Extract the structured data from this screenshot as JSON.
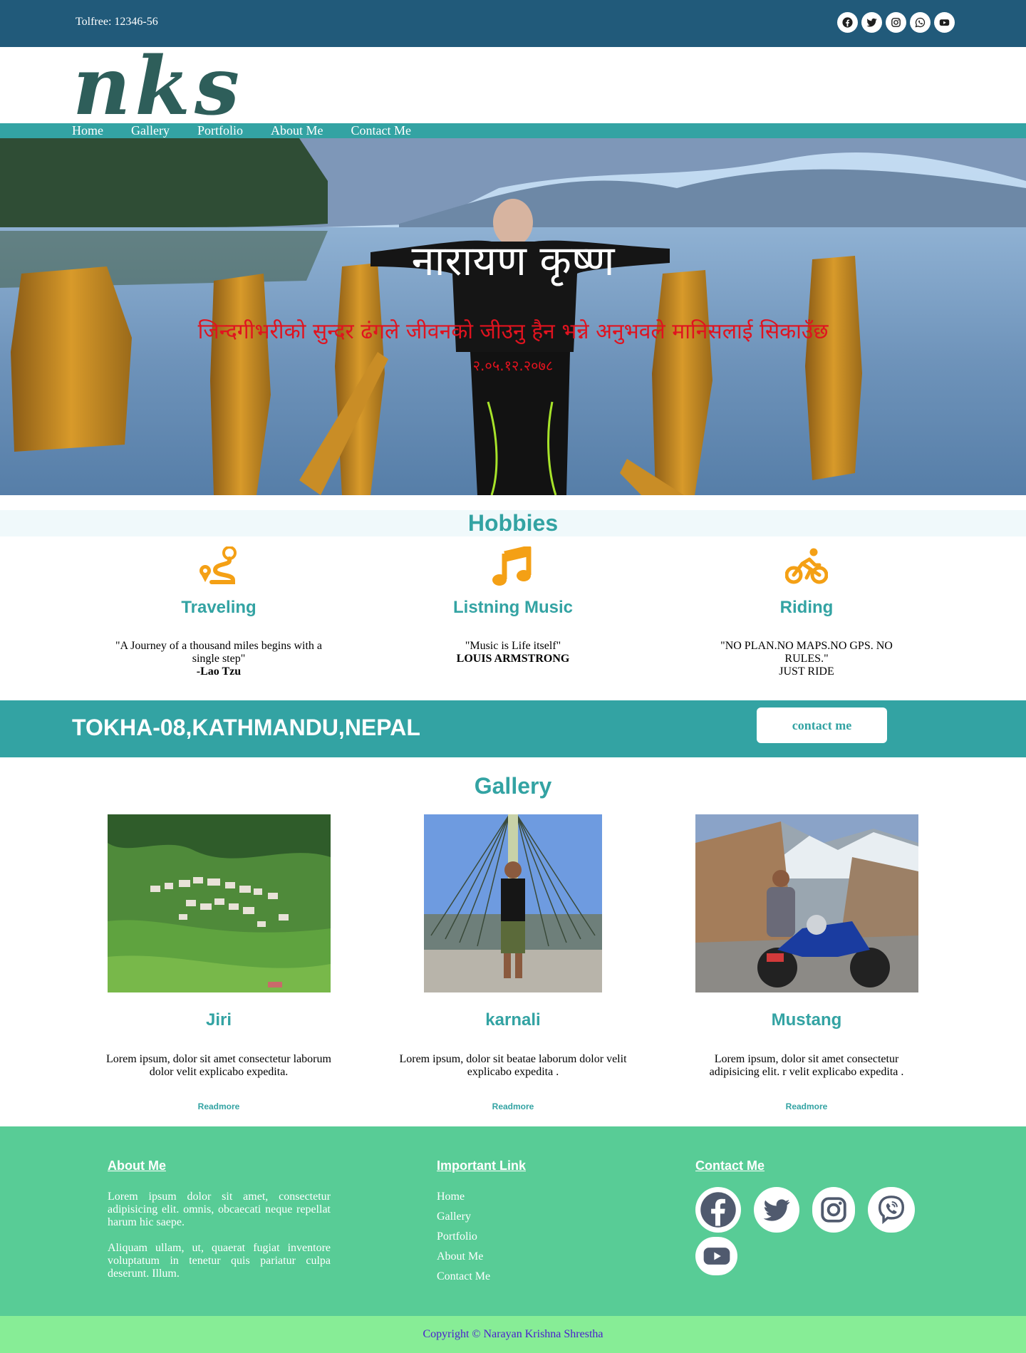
{
  "topbar": {
    "tollfree": "Tolfree: 12346-56",
    "socials": [
      "facebook-icon",
      "twitter-icon",
      "instagram-icon",
      "whatsapp-icon",
      "youtube-icon"
    ]
  },
  "logo": {
    "text": "nks"
  },
  "nav": {
    "items": [
      "Home",
      "Gallery",
      "Portfolio",
      "About Me",
      "Contact Me"
    ]
  },
  "hero": {
    "title": "नारायण कृष्ण",
    "quote": "जिन्दगीभरीको सुन्दर ढंगले जीवनको जीउनु हैन भन्ने अनुभवले मानिसलाई सिकाउँछ",
    "date": "२.०५.१२.२०७८"
  },
  "hobbies": {
    "heading": "Hobbies",
    "items": [
      {
        "icon": "route-icon",
        "title": "Traveling",
        "quote": "\"A Journey of a thousand miles begins with a single step\"",
        "author": "-Lao Tzu"
      },
      {
        "icon": "music-note-icon",
        "title": "Listning Music",
        "quote": "\"Music is Life itself\"",
        "author": "LOUIS ARMSTRONG"
      },
      {
        "icon": "bicycle-icon",
        "title": "Riding",
        "quote": "\"NO PLAN.NO MAPS.NO GPS. NO RULES.\"",
        "author": "JUST RIDE"
      }
    ]
  },
  "band": {
    "address": "TOKHA-08,KATHMANDU,NEPAL",
    "button": "contact me"
  },
  "gallery": {
    "heading": "Gallery",
    "items": [
      {
        "title": "Jiri",
        "text": "Lorem ipsum, dolor sit amet consectetur laborum dolor velit explicabo expedita.",
        "link": "Readmore"
      },
      {
        "title": "karnali",
        "text": "Lorem ipsum, dolor sit beatae laborum dolor velit explicabo expedita .",
        "link": "Readmore"
      },
      {
        "title": "Mustang",
        "text": "Lorem ipsum, dolor sit amet consectetur adipisicing elit. r velit explicabo expedita .",
        "link": "Readmore"
      }
    ]
  },
  "footer": {
    "about": {
      "heading": "About Me",
      "p1": "Lorem ipsum dolor sit amet, consectetur adipisicing elit. omnis, obcaecati neque repellat harum hic saepe.",
      "p2": "Aliquam ullam, ut, quaerat fugiat inventore voluptatum in tenetur quis pariatur culpa deserunt. Illum."
    },
    "links": {
      "heading": "Important Link",
      "items": [
        "Home",
        "Gallery",
        "Portfolio",
        "About Me",
        "Contact Me"
      ]
    },
    "contact": {
      "heading": "Contact Me",
      "icons": [
        "facebook-icon",
        "twitter-icon",
        "instagram-icon",
        "viber-icon",
        "youtube-icon"
      ]
    }
  },
  "copyright": "Copyright © Narayan Krishna Shrestha",
  "colors": {
    "topbar": "#215a7a",
    "accent": "#33a3a3",
    "hobby_icon": "#f4a015",
    "footer": "#58cc96",
    "copyright_bg": "#87ed96",
    "copyright_text": "#4a1ccf",
    "hero_quote": "#e0131f"
  }
}
